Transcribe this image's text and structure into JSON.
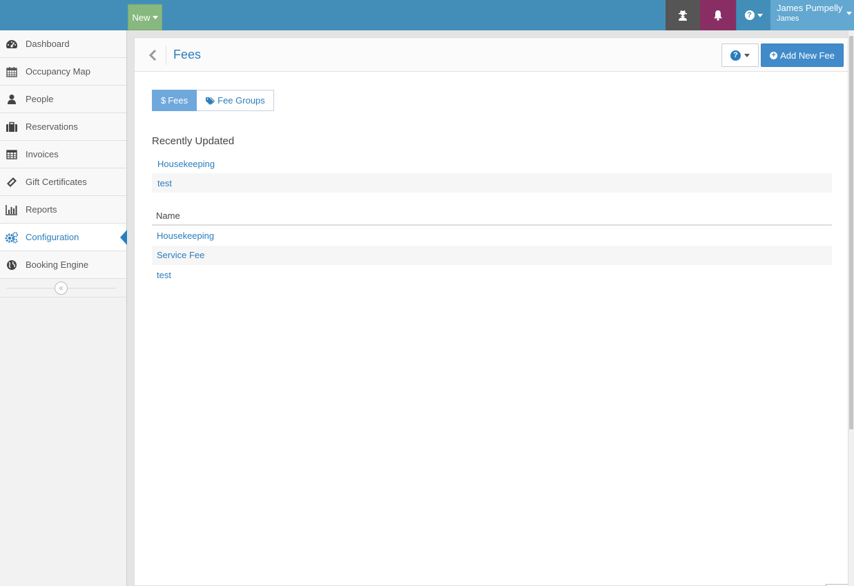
{
  "topbar": {
    "new_label": "New",
    "user_name": "James Pumpelly",
    "user_sub": "James",
    "colors": {
      "bar": "#438eb9",
      "new": "#87b87f",
      "spy": "#555555",
      "bell": "#892e65",
      "user": "#62a8d1"
    }
  },
  "sidebar": {
    "items": [
      {
        "label": "Dashboard",
        "icon": "tachometer-icon"
      },
      {
        "label": "Occupancy Map",
        "icon": "calendar-icon"
      },
      {
        "label": "People",
        "icon": "user-icon"
      },
      {
        "label": "Reservations",
        "icon": "briefcase-icon"
      },
      {
        "label": "Invoices",
        "icon": "table-icon"
      },
      {
        "label": "Gift Certificates",
        "icon": "ticket-icon"
      },
      {
        "label": "Reports",
        "icon": "bar-chart-icon"
      },
      {
        "label": "Configuration",
        "icon": "cogs-icon",
        "active": true
      },
      {
        "label": "Booking Engine",
        "icon": "globe-icon"
      }
    ],
    "collapse_symbol": "«"
  },
  "page": {
    "title": "Fees",
    "add_button": "Add New Fee",
    "tabs": [
      {
        "label": "Fees",
        "prefix": "$",
        "active": true
      },
      {
        "label": "Fee Groups",
        "icon": "tags-icon",
        "active": false
      }
    ],
    "recent_title": "Recently Updated",
    "recent_items": [
      "Housekeeping",
      "test"
    ],
    "table": {
      "header": "Name",
      "rows": [
        "Housekeeping",
        "Service Fee",
        "test"
      ]
    }
  }
}
